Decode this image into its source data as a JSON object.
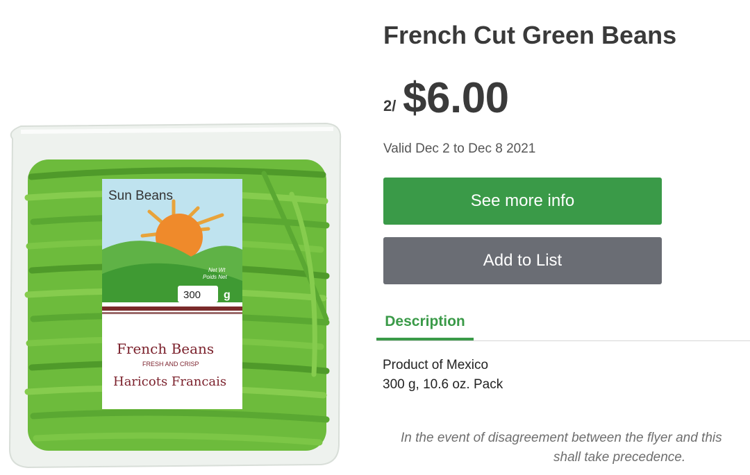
{
  "product": {
    "title": "French Cut Green Beans",
    "price_qty": "2/",
    "price": "$6.00",
    "valid": "Valid Dec 2 to Dec 8 2021"
  },
  "actions": {
    "info_label": "See more info",
    "add_label": "Add to List"
  },
  "tabs": {
    "description_label": "Description"
  },
  "description": {
    "line1": "Product of Mexico",
    "line2": "300 g, 10.6 oz. Pack"
  },
  "disclaimer": {
    "line1": "In the event of disagreement between the flyer and this",
    "line2": "shall take precedence."
  },
  "package": {
    "brand": "Sun Beans",
    "net_wt": "Net Wt",
    "poids_net": "Poids Net",
    "weight": "300",
    "unit": "g",
    "name_en": "French Beans",
    "tagline": "FRESH AND CRISP",
    "name_fr": "Haricots Francais"
  },
  "colors": {
    "accent_green": "#3a9a48",
    "button_gray": "#6a6d74"
  }
}
